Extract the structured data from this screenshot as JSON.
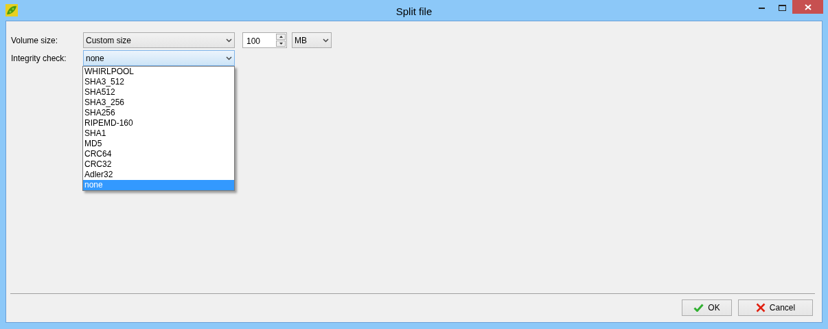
{
  "window": {
    "title": "Split file"
  },
  "volume_size": {
    "label": "Volume size:",
    "value": "Custom size",
    "amount": "100",
    "unit": "MB"
  },
  "integrity_check": {
    "label": "Integrity check:",
    "value": "none",
    "expanded": true,
    "options": [
      {
        "label": "WHIRLPOOL",
        "selected": false
      },
      {
        "label": "SHA3_512",
        "selected": false
      },
      {
        "label": "SHA512",
        "selected": false
      },
      {
        "label": "SHA3_256",
        "selected": false
      },
      {
        "label": "SHA256",
        "selected": false
      },
      {
        "label": "RIPEMD-160",
        "selected": false
      },
      {
        "label": "SHA1",
        "selected": false
      },
      {
        "label": "MD5",
        "selected": false
      },
      {
        "label": "CRC64",
        "selected": false
      },
      {
        "label": "CRC32",
        "selected": false
      },
      {
        "label": "Adler32",
        "selected": false
      },
      {
        "label": "none",
        "selected": true
      }
    ]
  },
  "buttons": [
    {
      "kind": "ok",
      "label": "OK"
    },
    {
      "kind": "cancel",
      "label": "Cancel"
    }
  ]
}
